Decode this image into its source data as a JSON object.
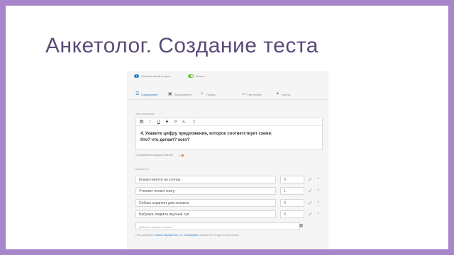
{
  "slide": {
    "title": "Анкетолог. Создание теста"
  },
  "topbar": {
    "badge": "1",
    "label": "Обязательный вопрос",
    "toggle_label": "Баллы"
  },
  "tabs": [
    {
      "label": "Содержание",
      "icon": "list-icon",
      "active": true
    },
    {
      "label": "Оформление",
      "icon": "image-icon",
      "active": false
    },
    {
      "label": "Логика",
      "icon": "branch-icon",
      "active": false
    },
    {
      "label": "Настройки",
      "icon": "monitor-icon",
      "active": false
    },
    {
      "label": "Баллы",
      "icon": "puzzle-icon",
      "active": false
    }
  ],
  "question": {
    "label": "Текст вопроса",
    "toolbar": [
      "B",
      "I",
      "U",
      "S",
      "x²",
      "x₂",
      "T̲"
    ],
    "line1": "4. Укажите цифру предложения, которое соответствует схеме:",
    "line2": "Кто? что делает? кого?"
  },
  "random_order_label": "Случайный порядок ответов",
  "answers_label": "Варианты",
  "answers": [
    {
      "text": "Кошка греется на солнце.",
      "order": "0"
    },
    {
      "text": "Ученики читают книгу.",
      "order": "1"
    },
    {
      "text": "Собака охраняет дом хозяина.",
      "order": "0"
    },
    {
      "text": "Бабушка сварила вкусный суп.",
      "order": "0"
    }
  ],
  "add_answer_placeholder": "Добавьте вариант ответа",
  "footer": {
    "prefix": "Или добавьте ",
    "link1": "список вариантов",
    "middle": " или ",
    "link2": "скопируйте",
    "suffix": " варианты из других вопросов"
  },
  "colors": {
    "background": "#a785c9",
    "accent": "#2b7bc9",
    "check": "#6cc24a",
    "toggle_off_knob": "#f07a3a"
  }
}
